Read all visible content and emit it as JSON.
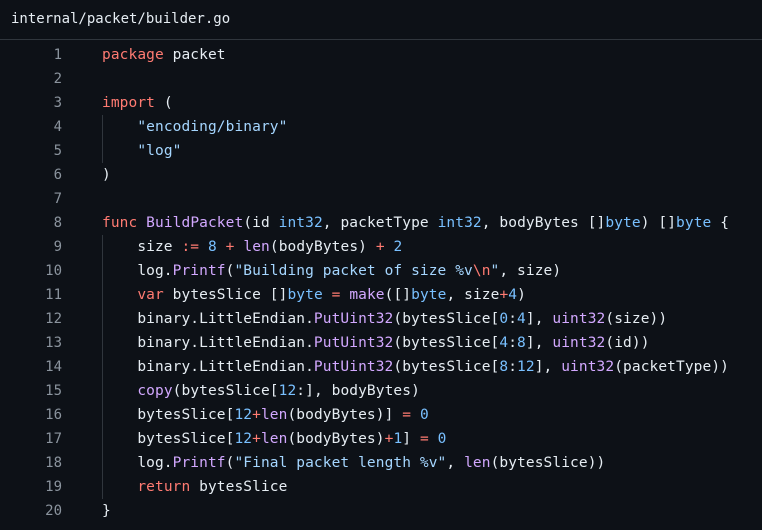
{
  "file": {
    "path": "internal/packet/builder.go"
  },
  "colors": {
    "background": "#0d1117",
    "keyword": "#ff7b72",
    "type": "#79c0ff",
    "function": "#d2a8ff",
    "string": "#a5d6ff",
    "number": "#79c0ff",
    "line_number": "#8b949e",
    "text": "#e6edf3"
  },
  "lines": [
    {
      "number": "1",
      "guide": false,
      "tokens": [
        [
          "keyword",
          "package"
        ],
        [
          "plain",
          " packet"
        ]
      ]
    },
    {
      "number": "2",
      "guide": false,
      "tokens": []
    },
    {
      "number": "3",
      "guide": false,
      "tokens": [
        [
          "keyword",
          "import"
        ],
        [
          "plain",
          " ("
        ]
      ]
    },
    {
      "number": "4",
      "guide": true,
      "tokens": [
        [
          "plain",
          "    "
        ],
        [
          "string",
          "\"encoding/binary\""
        ]
      ]
    },
    {
      "number": "5",
      "guide": true,
      "tokens": [
        [
          "plain",
          "    "
        ],
        [
          "string",
          "\"log\""
        ]
      ]
    },
    {
      "number": "6",
      "guide": false,
      "tokens": [
        [
          "plain",
          ")"
        ]
      ]
    },
    {
      "number": "7",
      "guide": false,
      "tokens": []
    },
    {
      "number": "8",
      "guide": false,
      "tokens": [
        [
          "keyword",
          "func"
        ],
        [
          "plain",
          " "
        ],
        [
          "func",
          "BuildPacket"
        ],
        [
          "plain",
          "(id "
        ],
        [
          "type",
          "int32"
        ],
        [
          "plain",
          ", packetType "
        ],
        [
          "type",
          "int32"
        ],
        [
          "plain",
          ", bodyBytes []"
        ],
        [
          "type",
          "byte"
        ],
        [
          "plain",
          ") []"
        ],
        [
          "type",
          "byte"
        ],
        [
          "plain",
          " {"
        ]
      ]
    },
    {
      "number": "9",
      "guide": true,
      "tokens": [
        [
          "plain",
          "    size "
        ],
        [
          "operator",
          ":="
        ],
        [
          "plain",
          " "
        ],
        [
          "number",
          "8"
        ],
        [
          "plain",
          " "
        ],
        [
          "operator",
          "+"
        ],
        [
          "plain",
          " "
        ],
        [
          "builtin",
          "len"
        ],
        [
          "plain",
          "(bodyBytes) "
        ],
        [
          "operator",
          "+"
        ],
        [
          "plain",
          " "
        ],
        [
          "number",
          "2"
        ]
      ]
    },
    {
      "number": "10",
      "guide": true,
      "tokens": [
        [
          "plain",
          "    log."
        ],
        [
          "func",
          "Printf"
        ],
        [
          "plain",
          "("
        ],
        [
          "string",
          "\"Building packet of size %v"
        ],
        [
          "escape",
          "\\n"
        ],
        [
          "string",
          "\""
        ],
        [
          "plain",
          ", size)"
        ]
      ]
    },
    {
      "number": "11",
      "guide": true,
      "tokens": [
        [
          "plain",
          "    "
        ],
        [
          "keyword",
          "var"
        ],
        [
          "plain",
          " bytesSlice []"
        ],
        [
          "type",
          "byte"
        ],
        [
          "plain",
          " "
        ],
        [
          "operator",
          "="
        ],
        [
          "plain",
          " "
        ],
        [
          "builtin",
          "make"
        ],
        [
          "plain",
          "([]"
        ],
        [
          "type",
          "byte"
        ],
        [
          "plain",
          ", size"
        ],
        [
          "operator",
          "+"
        ],
        [
          "number",
          "4"
        ],
        [
          "plain",
          ")"
        ]
      ]
    },
    {
      "number": "12",
      "guide": true,
      "tokens": [
        [
          "plain",
          "    binary.LittleEndian."
        ],
        [
          "func",
          "PutUint32"
        ],
        [
          "plain",
          "(bytesSlice["
        ],
        [
          "number",
          "0"
        ],
        [
          "plain",
          ":"
        ],
        [
          "number",
          "4"
        ],
        [
          "plain",
          "], "
        ],
        [
          "func",
          "uint32"
        ],
        [
          "plain",
          "(size))"
        ]
      ]
    },
    {
      "number": "13",
      "guide": true,
      "tokens": [
        [
          "plain",
          "    binary.LittleEndian."
        ],
        [
          "func",
          "PutUint32"
        ],
        [
          "plain",
          "(bytesSlice["
        ],
        [
          "number",
          "4"
        ],
        [
          "plain",
          ":"
        ],
        [
          "number",
          "8"
        ],
        [
          "plain",
          "], "
        ],
        [
          "func",
          "uint32"
        ],
        [
          "plain",
          "(id))"
        ]
      ]
    },
    {
      "number": "14",
      "guide": true,
      "tokens": [
        [
          "plain",
          "    binary.LittleEndian."
        ],
        [
          "func",
          "PutUint32"
        ],
        [
          "plain",
          "(bytesSlice["
        ],
        [
          "number",
          "8"
        ],
        [
          "plain",
          ":"
        ],
        [
          "number",
          "12"
        ],
        [
          "plain",
          "], "
        ],
        [
          "func",
          "uint32"
        ],
        [
          "plain",
          "(packetType))"
        ]
      ]
    },
    {
      "number": "15",
      "guide": true,
      "tokens": [
        [
          "plain",
          "    "
        ],
        [
          "builtin",
          "copy"
        ],
        [
          "plain",
          "(bytesSlice["
        ],
        [
          "number",
          "12"
        ],
        [
          "plain",
          ":], bodyBytes)"
        ]
      ]
    },
    {
      "number": "16",
      "guide": true,
      "tokens": [
        [
          "plain",
          "    bytesSlice["
        ],
        [
          "number",
          "12"
        ],
        [
          "operator",
          "+"
        ],
        [
          "builtin",
          "len"
        ],
        [
          "plain",
          "(bodyBytes)] "
        ],
        [
          "operator",
          "="
        ],
        [
          "plain",
          " "
        ],
        [
          "number",
          "0"
        ]
      ]
    },
    {
      "number": "17",
      "guide": true,
      "tokens": [
        [
          "plain",
          "    bytesSlice["
        ],
        [
          "number",
          "12"
        ],
        [
          "operator",
          "+"
        ],
        [
          "builtin",
          "len"
        ],
        [
          "plain",
          "(bodyBytes)"
        ],
        [
          "operator",
          "+"
        ],
        [
          "number",
          "1"
        ],
        [
          "plain",
          "] "
        ],
        [
          "operator",
          "="
        ],
        [
          "plain",
          " "
        ],
        [
          "number",
          "0"
        ]
      ]
    },
    {
      "number": "18",
      "guide": true,
      "tokens": [
        [
          "plain",
          "    log."
        ],
        [
          "func",
          "Printf"
        ],
        [
          "plain",
          "("
        ],
        [
          "string",
          "\"Final packet length %v\""
        ],
        [
          "plain",
          ", "
        ],
        [
          "builtin",
          "len"
        ],
        [
          "plain",
          "(bytesSlice))"
        ]
      ]
    },
    {
      "number": "19",
      "guide": true,
      "tokens": [
        [
          "plain",
          "    "
        ],
        [
          "keyword",
          "return"
        ],
        [
          "plain",
          " bytesSlice"
        ]
      ]
    },
    {
      "number": "20",
      "guide": false,
      "tokens": [
        [
          "plain",
          "}"
        ]
      ]
    }
  ]
}
